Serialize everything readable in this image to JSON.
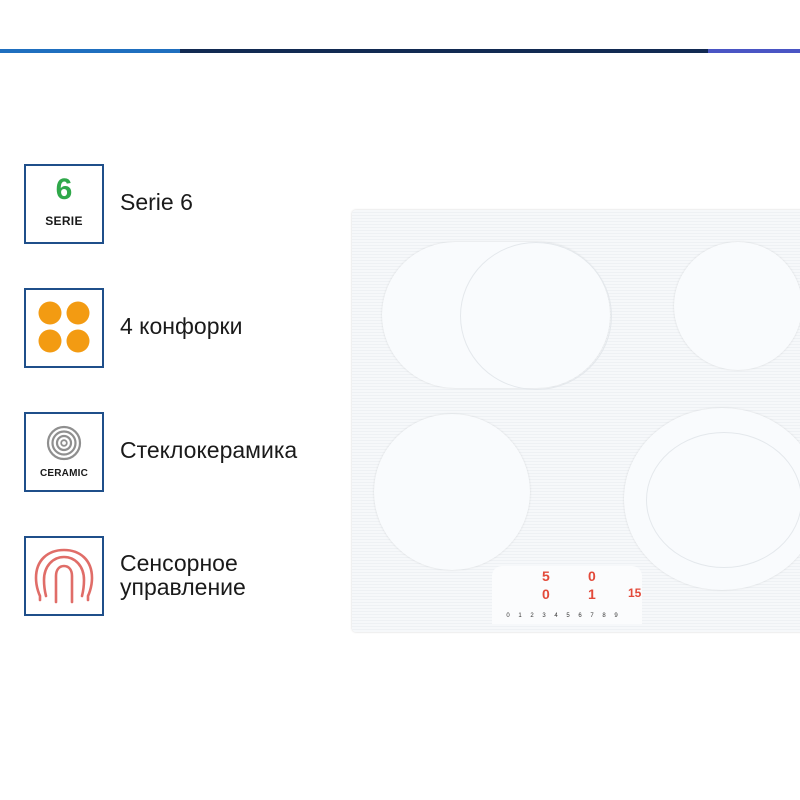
{
  "colors": {
    "accent_bar": [
      "#1f6fbf",
      "#122a52",
      "#4a55c4"
    ],
    "frame": "#1f4f8a",
    "serie_green": "#2fa84a",
    "burner_orange": "#f39b12",
    "touch_red": "#e06d68"
  },
  "features": [
    {
      "icon": "serie-6-icon",
      "icon_number": "6",
      "icon_text": "SERIE",
      "label": "Serie 6"
    },
    {
      "icon": "four-burners-icon",
      "label": "4 конфорки"
    },
    {
      "icon": "ceramic-glass-icon",
      "icon_text": "CERAMIC",
      "label": "Стеклокерамика"
    },
    {
      "icon": "touch-control-icon",
      "label": "Сенсорное\nуправление"
    }
  ]
}
